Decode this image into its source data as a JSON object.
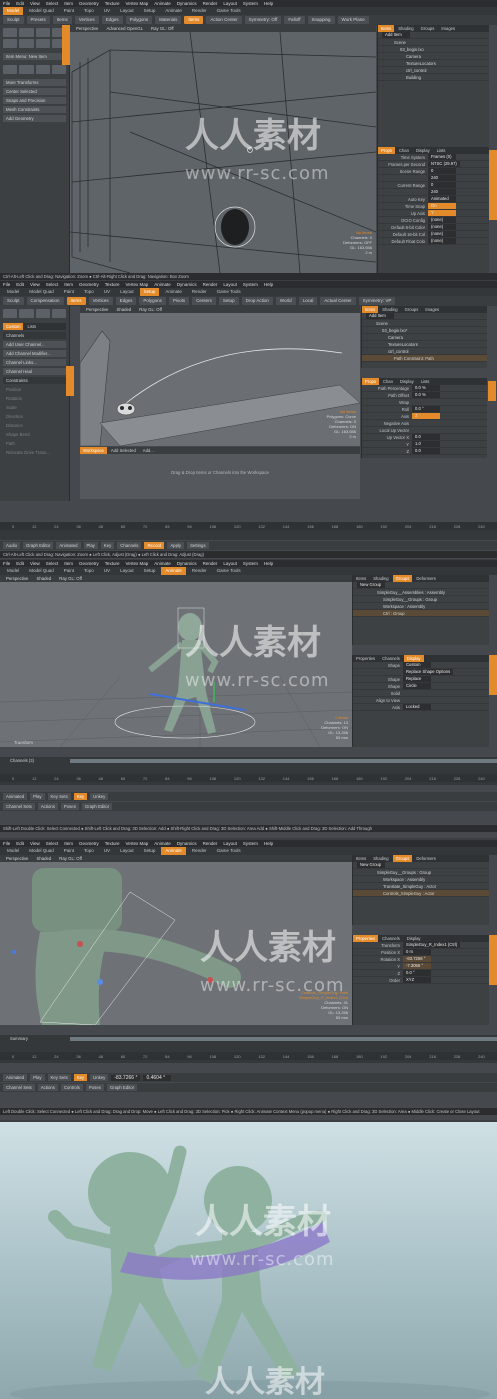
{
  "menu": [
    "File",
    "Edit",
    "View",
    "Select",
    "Item",
    "Geometry",
    "Texture",
    "Vertex Map",
    "Animate",
    "Dynamics",
    "Render",
    "Layout",
    "System",
    "Help"
  ],
  "panel1": {
    "tabs": [
      "Model",
      "Model Quad",
      "Paint",
      "Topo",
      "UV",
      "Layout",
      "Setup",
      "Animate",
      "Render",
      "Game Tools"
    ],
    "active_tab": "Model",
    "toolbar": [
      "Sculpt",
      "Presets",
      "Items",
      "Vertices",
      "Edges",
      "Polygons",
      "Materials",
      "Items",
      "Action Center",
      "Symmetry: Off",
      "Falloff",
      "Snapping",
      "Work Plane"
    ],
    "viewport_header": [
      "Perspective",
      "Advanced OpenGL",
      "Ray GL: Off"
    ],
    "left_buttons": [
      "Item Menu: New Item",
      "More Transforms",
      "Center Selected",
      "Snaps and Precision",
      "Mesh Constraints",
      "Add Geometry"
    ],
    "info": [
      "No Items",
      "Channels: 0",
      "Deformers: OFF",
      "GL: 163,656",
      "2 m"
    ],
    "status": "Ctrl-Alt-Left Click and Drag: Navigation: Zoom ● Ctrl-Alt-Right Click and Drag: Navigation: Box Zoom",
    "items_tabs": [
      "Items",
      "Shading",
      "Groups",
      "Images"
    ],
    "items_header": "Add Item",
    "items": [
      "Scene",
      "03_begin.lxo",
      "Camera",
      "TextureLocators",
      "ctrl_control",
      "Building"
    ],
    "props_tabs": [
      "Props",
      "Chan",
      "Display",
      "Lists"
    ],
    "props": [
      {
        "label": "Time System",
        "value": "Frames (0)"
      },
      {
        "label": "Frames per Second",
        "value": "NTSC (29.97)"
      },
      {
        "label": "Scene Range",
        "value": "0"
      },
      {
        "label": "",
        "value": "240"
      },
      {
        "label": "Current Range",
        "value": "0"
      },
      {
        "label": "",
        "value": "240"
      },
      {
        "label": "Auto Key",
        "value": "Animated"
      },
      {
        "label": "Time Snap",
        "value": "On"
      },
      {
        "label": "Up Axis",
        "value": "Y"
      },
      {
        "label": "OCIO Config",
        "value": "(none)"
      },
      {
        "label": "Default 8-bit Color",
        "value": "(none)"
      },
      {
        "label": "Default 16-bit Col",
        "value": "(none)"
      },
      {
        "label": "Default Float Colo",
        "value": "(none)"
      }
    ]
  },
  "panel2": {
    "toolbar": [
      "Sculpt",
      "Compensation",
      "Items",
      "Vertices",
      "Edges",
      "Polygons",
      "Pivots",
      "Centers",
      "Setup",
      "Drop Action",
      "World",
      "Local",
      "Actual Center",
      "Symmetry: VP"
    ],
    "viewport_header": [
      "Perspective",
      "Shaded",
      "Ray GL: Off"
    ],
    "left_tabs": [
      "Custom",
      "Lists"
    ],
    "channels_label": "Channels",
    "channel_buttons": [
      "Add User Channel...",
      "Add Channel Modifier...",
      "Channel Links...",
      "Channel Haul"
    ],
    "constraints_label": "Constraints",
    "constraint_items": [
      "Position",
      "Rotation",
      "Scale",
      "Direction",
      "Distance",
      "Shape Bend",
      "Path",
      "Relocate Drive Trans..."
    ],
    "items": [
      "Scene",
      "03_begin.lxo*",
      "Camera",
      "TextureLocators",
      "ctrl_control",
      "Path Constraint: Path"
    ],
    "items_header": "Add Item",
    "props": [
      {
        "label": "Path Percentage",
        "value": "0.0 %"
      },
      {
        "label": "Path Offset",
        "value": "0.0 %"
      },
      {
        "label": "Wrap",
        "value": ""
      },
      {
        "label": "Roll",
        "value": "0.0 °"
      },
      {
        "label": "Axis",
        "value": "Z"
      },
      {
        "label": "Negative Axis",
        "value": ""
      },
      {
        "label": "Local Up Vector",
        "value": ""
      },
      {
        "label": "Up Vector X",
        "value": "0.0"
      },
      {
        "label": "Y",
        "value": "1.0"
      },
      {
        "label": "Z",
        "value": "0.0"
      }
    ],
    "info": [
      "No Items",
      "Polygons: Curve",
      "Channels: 0",
      "Deformers: ON",
      "GL: 163,656",
      "2 m"
    ],
    "workspace_bar": [
      "Workspace",
      "Add Selected",
      "Add..."
    ],
    "workspace_hint": "Drag & Drop Items or Channels into the Workspace",
    "ruler": [
      "0",
      "12",
      "24",
      "36",
      "48",
      "60",
      "72",
      "84",
      "96",
      "108",
      "120",
      "132",
      "144",
      "156",
      "168",
      "180",
      "192",
      "204",
      "216",
      "228",
      "240"
    ],
    "controls": [
      "Audio",
      "Graph Editor",
      "Animated",
      "Play",
      "Key",
      "Channels",
      "Record",
      "Apply",
      "Settings"
    ],
    "status": "Ctrl-Alt-Left Click and Drag: Navigation: Zoom ● Left Click, Adjust (Drag) ● Left Click and Drag: Adjust (Drag)"
  },
  "panel3": {
    "viewport_header": [
      "Perspective",
      "Shaded",
      "Ray GL: Off"
    ],
    "groups_tabs": [
      "Items",
      "Shading",
      "Groups",
      "Deformers"
    ],
    "groups_header": "New Group",
    "groups": [
      "SimpleGuy__Assemblies : Assembly",
      "SimpleGuy__Groups : Group",
      "Workspace : Assembly",
      "Ctrl : Group"
    ],
    "props_tabs": [
      "Properties",
      "Channels",
      "Display"
    ],
    "props": [
      {
        "label": "Shape",
        "value": "Custom"
      },
      {
        "label": "",
        "value": "Replace Shape Options"
      },
      {
        "label": "Shape",
        "value": "Replace"
      },
      {
        "label": "Shape",
        "value": "Circle"
      },
      {
        "label": "Solid",
        "value": ""
      },
      {
        "label": "Align to View",
        "value": ""
      },
      {
        "label": "Axis",
        "value": "Locked"
      }
    ],
    "info": [
      "1 Items",
      "Channels: 13",
      "Deformers: ON",
      "GL: 13,256",
      "50 mm"
    ],
    "layer_label": "Transform",
    "timeline_label": "Channels (3)",
    "ruler": [
      "0",
      "12",
      "24",
      "36",
      "48",
      "60",
      "72",
      "84",
      "96",
      "108",
      "120",
      "132",
      "144",
      "156",
      "168",
      "180",
      "192",
      "204",
      "216",
      "228",
      "240"
    ],
    "controls": [
      "Animated",
      "Play",
      "Key Sets",
      "Channel Sets",
      "Actions",
      "Poses",
      "Graph Editor",
      "Key",
      "Unkey"
    ],
    "status": "Shift-Left Double Click: Select Connected ● Shift-Left Click and Drag: 3D Selection: Add ● Shift-Right Click and Drag: 3D Selection: Area Add ● Shift-Middle Click and Drag: 3D Selection: Add Through"
  },
  "panel4": {
    "viewport_header": [
      "Perspective",
      "Shaded",
      "Ray GL: Off"
    ],
    "groups_tabs": [
      "Items",
      "Shading",
      "Groups",
      "Deformers"
    ],
    "groups_header": "New Group",
    "groups": [
      "SimpleGuy__Groups : Group",
      "Workspace : Assembly",
      "Translate_SimpleGuy : Actor",
      "Controls_SimpleGuy : Actor"
    ],
    "props_tabs": [
      "Properties",
      "Channels",
      "Display"
    ],
    "props": [
      {
        "label": "Transform",
        "value": "SimpleGuy_R_Index1 (Ctrl)"
      },
      {
        "label": "Position X",
        "value": "0 m"
      },
      {
        "label": "Rotation X",
        "value": "-83.7266 °"
      },
      {
        "label": "Y",
        "value": "-7.3056 °"
      },
      {
        "label": "Z",
        "value": "0.0 °"
      },
      {
        "label": "Order",
        "value": "XYZ"
      }
    ],
    "info": [
      "Controls_SimpleGuy: Path",
      "SimpleGuy_R_Index1 (Ctrl)",
      "Channels: 31",
      "Deformers: ON",
      "GL: 13,256",
      "50 mm"
    ],
    "layer_label": "Summary",
    "ruler": [
      "0",
      "12",
      "24",
      "36",
      "48",
      "60",
      "72",
      "84",
      "96",
      "108",
      "120",
      "132",
      "144",
      "156",
      "168",
      "180",
      "192",
      "204",
      "216",
      "228",
      "240"
    ],
    "controls": [
      "Animated",
      "Play",
      "Key Sets",
      "Channel Sets",
      "Actions",
      "Controls",
      "Poses",
      "Graph Editor",
      "Key",
      "Unkey"
    ],
    "values": [
      "-83.7266 °",
      "0.4604 °"
    ],
    "status": "Left Double Click: Select Connected ● Left Click and Drag: Drag and Drop: Move ● Left Click and Drag: 3D Selection: Pick ● Right Click: Animate Context Menu (popup menu) ● Right Click and Drag: 3D Selection: Area ● Middle Click: Create or Close Layout"
  },
  "watermark": {
    "cn": "人人素材",
    "url": "www.rr-sc.com"
  },
  "colors": {
    "accent": "#e38a2a",
    "bg": "#45484c",
    "viewport": "#6a6e72",
    "render_figure": "#8fb2a0",
    "ribbon": "#8a74c8"
  }
}
